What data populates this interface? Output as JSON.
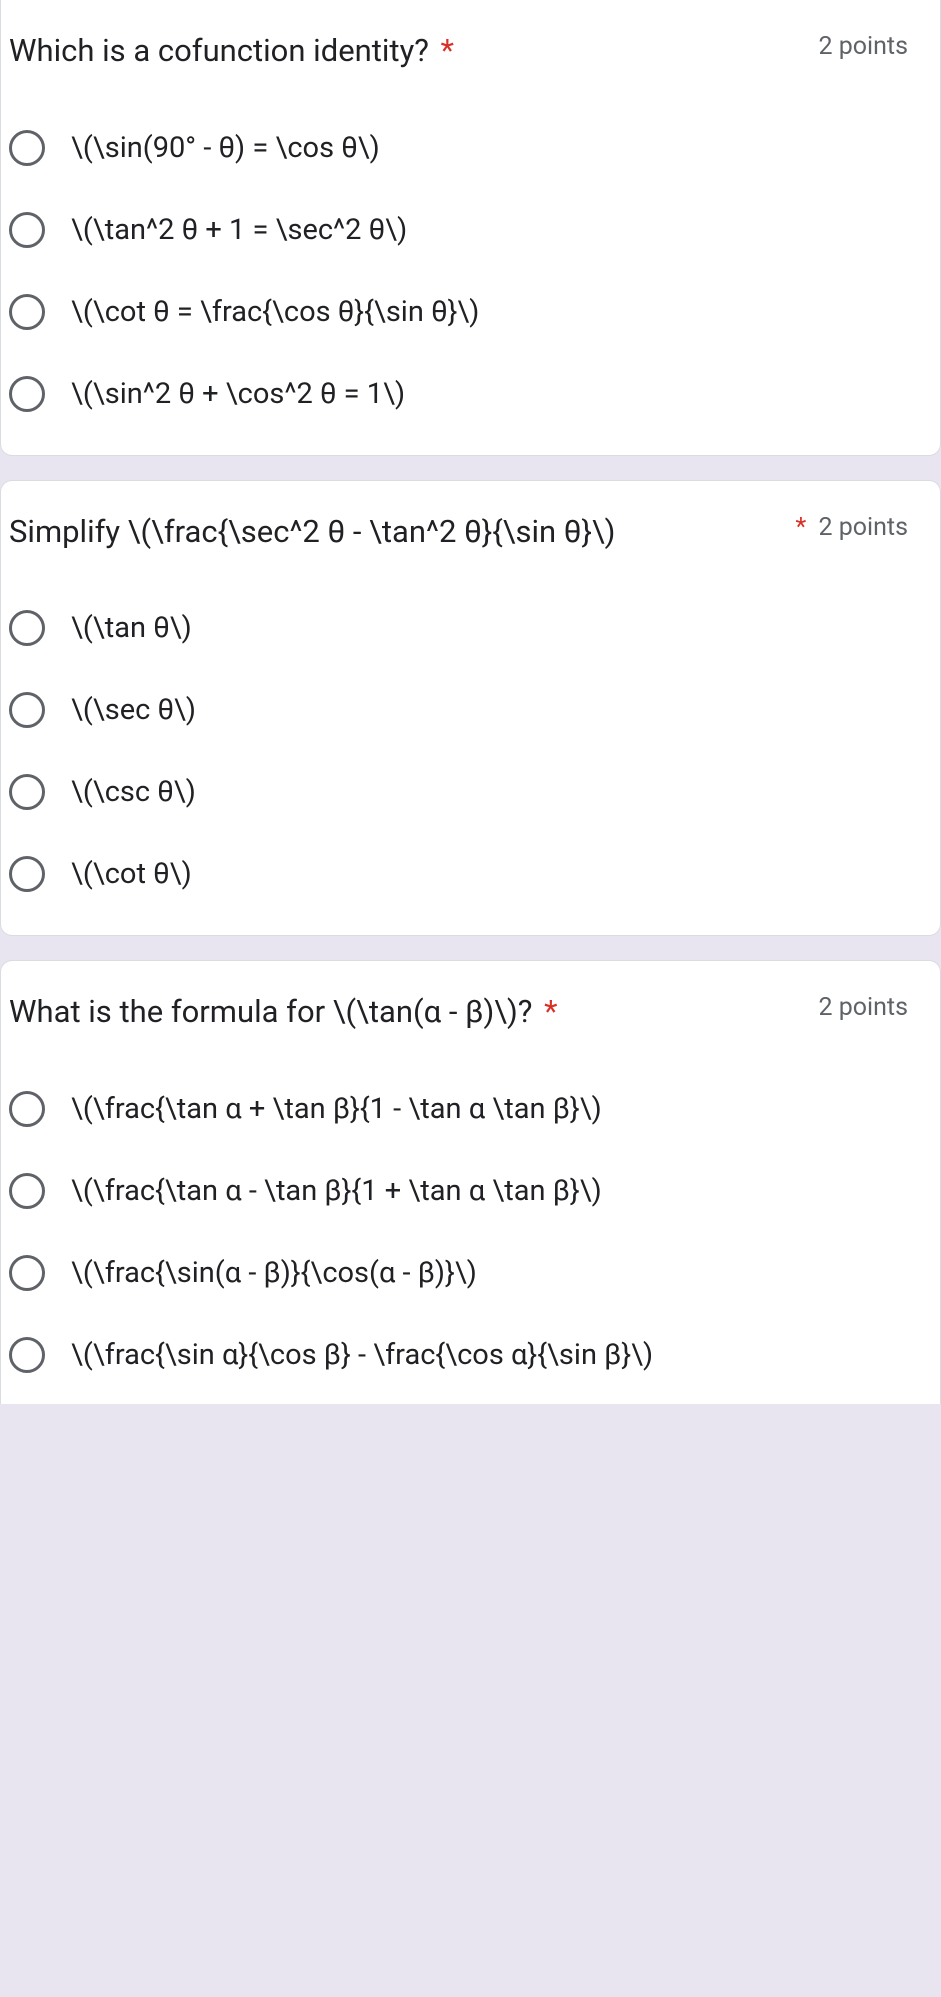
{
  "questions": [
    {
      "title": "Which is a cofunction identity?",
      "required": true,
      "points": "2 points",
      "options": [
        "\\(\\sin(90° - θ) = \\cos θ\\)",
        "\\(\\tan^2 θ + 1 = \\sec^2 θ\\)",
        "\\(\\cot θ = \\frac{\\cos θ}{\\sin θ}\\)",
        "\\(\\sin^2 θ + \\cos^2 θ = 1\\)"
      ]
    },
    {
      "title": "Simplify \\(\\frac{\\sec^2 θ - \\tan^2 θ}{\\sin θ}\\)",
      "required": true,
      "points": "2 points",
      "options": [
        "\\(\\tan θ\\)",
        "\\(\\sec θ\\)",
        "\\(\\csc θ\\)",
        "\\(\\cot θ\\)"
      ]
    },
    {
      "title": "What is the formula for \\(\\tan(α - β)\\)?",
      "required": true,
      "points": "2 points",
      "options": [
        "\\(\\frac{\\tan α + \\tan β}{1 - \\tan α \\tan β}\\)",
        "\\(\\frac{\\tan α - \\tan β}{1 + \\tan α \\tan β}\\)",
        "\\(\\frac{\\sin(α - β)}{\\cos(α - β)}\\)",
        "\\(\\frac{\\sin α}{\\cos β} - \\frac{\\cos α}{\\sin β}\\)"
      ]
    }
  ],
  "required_marker": "*"
}
